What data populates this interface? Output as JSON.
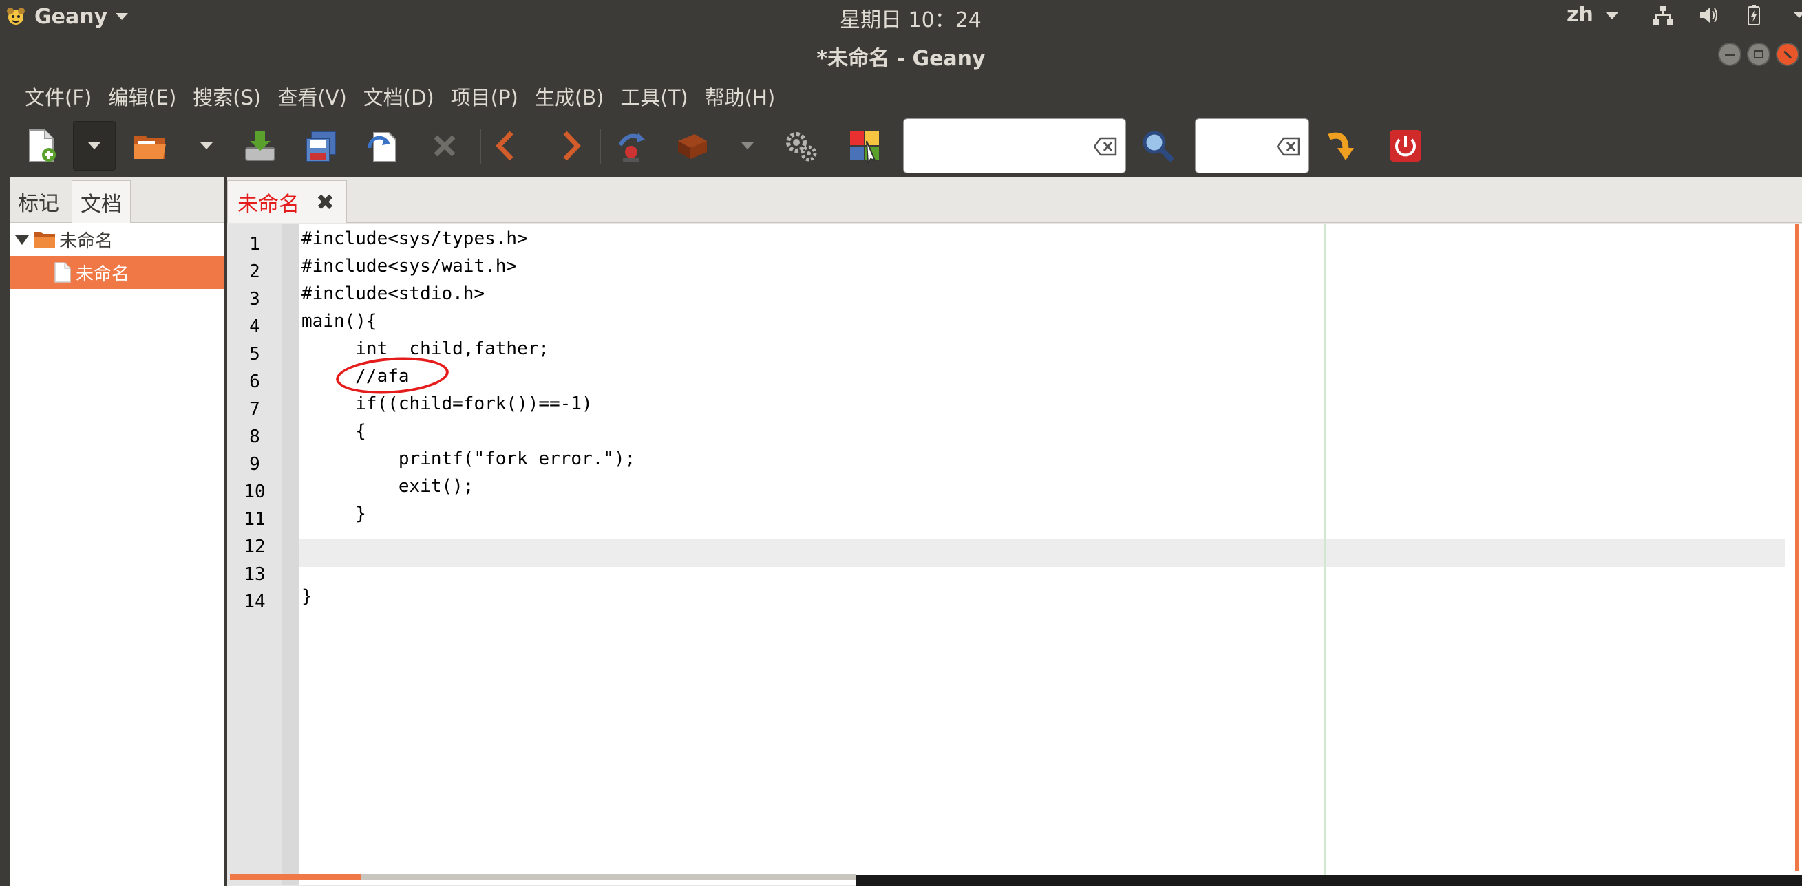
{
  "top_panel": {
    "app_name": "Geany",
    "clock": "星期日 10：24",
    "lang": "zh"
  },
  "window": {
    "title": "*未命名 - Geany"
  },
  "menu": {
    "items": [
      "文件(F)",
      "编辑(E)",
      "搜索(S)",
      "查看(V)",
      "文档(D)",
      "项目(P)",
      "生成(B)",
      "工具(T)",
      "帮助(H)"
    ]
  },
  "toolbar": {
    "search_value": "",
    "goto_value": ""
  },
  "sidebar": {
    "tabs": [
      "标记",
      "文档"
    ],
    "active_tab": "文档",
    "tree": {
      "folder": "未命名",
      "file": "未命名"
    }
  },
  "editor": {
    "tab_name": "未命名",
    "tab_close": "✖",
    "line_numbers": [
      "1",
      "2",
      "3",
      "4",
      "5",
      "6",
      "7",
      "8",
      "9",
      "10",
      "11",
      "12",
      "13",
      "14"
    ],
    "lines": [
      "#include<sys/types.h>",
      "#include<sys/wait.h>",
      "#include<stdio.h>",
      "main(){",
      "     int  child,father;",
      "     //afa",
      "     if((child=fork())==-1)",
      "     {",
      "         printf(\"fork error.\");",
      "         exit();",
      "     }",
      "",
      "",
      "}"
    ],
    "current_line": 6
  },
  "colors": {
    "accent": "#f07746",
    "tab_modified": "#e41c1c",
    "panel": "#3c3b37"
  }
}
